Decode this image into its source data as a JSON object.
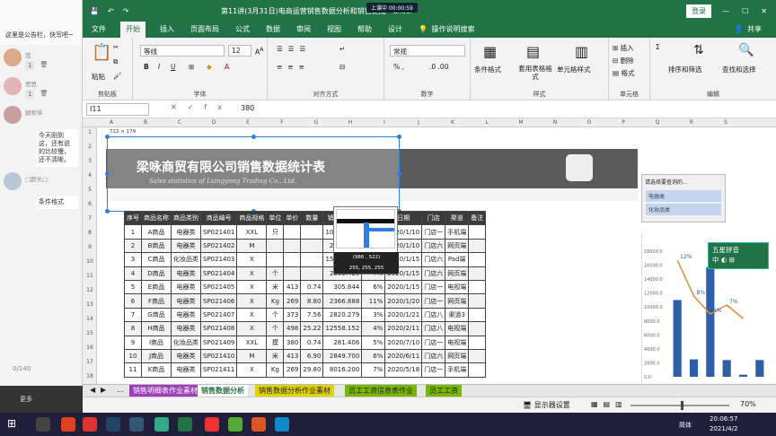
{
  "chat": {
    "notice": "这里是公告栏，快写吧~",
    "users": [
      {
        "name": "莲",
        "count": "1"
      },
      {
        "name": "思思",
        "count": "1"
      },
      {
        "name": "颖熙爷",
        "msg": "今天刚到这，还有说的比较慢，还不清晰。"
      },
      {
        "name": "□颜头□",
        "msg": "条件格式"
      }
    ],
    "counter": "0/140",
    "footer": "更多"
  },
  "window": {
    "title": "第11讲(3月31日)电商运营销售数据分析和销售提成 - Excel",
    "recording": "上课中 00:00:59",
    "login": "登录",
    "share": "共享"
  },
  "tabs": [
    "文件",
    "开始",
    "插入",
    "页面布局",
    "公式",
    "数据",
    "审阅",
    "视图",
    "帮助",
    "设计",
    "操作说明搜索"
  ],
  "ribbon": {
    "paste": "粘贴",
    "clipboard": "剪贴板",
    "font_name": "等线",
    "font_size": "12",
    "font": "字体",
    "align": "对齐方式",
    "num_format": "常规",
    "number": "数字",
    "cond": "条件格式",
    "table": "套用表格格式",
    "cellstyle": "单元格样式",
    "styles": "样式",
    "insert": "插入",
    "delete": "删除",
    "format": "格式",
    "cells": "单元格",
    "sort": "排序和筛选",
    "find": "查找和选择",
    "edit": "编辑"
  },
  "formula": {
    "name_box": "I11",
    "value": "380"
  },
  "banner": {
    "title": "梁咏商贸有限公司销售数据统计表",
    "subtitle": "Sales statistics of Liangyong Trading Co., Ltd.",
    "sel_dim": "722 × 179"
  },
  "table": {
    "headers": [
      "序号",
      "商品名称",
      "商品类别",
      "商品编号",
      "商品规格",
      "单位",
      "单价",
      "数量",
      "销售额(万)",
      "利润率",
      "日期",
      "门店",
      "渠道",
      "备注"
    ],
    "rows": [
      [
        "1",
        "A商品",
        "电器类",
        "SP021401",
        "XXL",
        "只",
        "",
        "",
        "10870.332",
        "12%",
        "2020/1/10",
        "门店一",
        "手机端",
        ""
      ],
      [
        "2",
        "B商品",
        "电器类",
        "SP021402",
        "M",
        "",
        "",
        "",
        "2566.228",
        "8%",
        "2020/1/10",
        "门店六",
        "网页端",
        ""
      ],
      [
        "3",
        "C商品",
        "化妆品类",
        "SP021403",
        "X",
        "",
        "",
        "",
        "15748.344",
        "6%",
        "2020/1/15",
        "门店六",
        "Pad端",
        ""
      ],
      [
        "4",
        "D商品",
        "电器类",
        "SP021404",
        "X",
        "个",
        "",
        "",
        "2363.420",
        "7%",
        "2020/1/15",
        "门店六",
        "网页端",
        ""
      ],
      [
        "5",
        "E商品",
        "电器类",
        "SP021405",
        "X",
        "米",
        "413",
        "0.74",
        "305.844",
        "6%",
        "2020/1/15",
        "门店一",
        "电视端",
        ""
      ],
      [
        "6",
        "F商品",
        "电器类",
        "SP021406",
        "X",
        "Kg",
        "269",
        "8.80",
        "2366.888",
        "11%",
        "2020/1/20",
        "门店一",
        "网页端",
        ""
      ],
      [
        "7",
        "G商品",
        "电器类",
        "SP021407",
        "X",
        "个",
        "373",
        "7.56",
        "2820.279",
        "3%",
        "2020/1/21",
        "门店八",
        "渠道3",
        ""
      ],
      [
        "8",
        "H商品",
        "电器类",
        "SP021408",
        "X",
        "个",
        "498",
        "25.22",
        "12558.152",
        "4%",
        "2020/2/11",
        "门店八",
        "电视端",
        ""
      ],
      [
        "9",
        "I商品",
        "化妆品类",
        "SP021409",
        "XXL",
        "摸",
        "380",
        "0.74",
        "281.406",
        "5%",
        "2020/7/10",
        "门店一",
        "电视端",
        ""
      ],
      [
        "10",
        "J商品",
        "电器类",
        "SP021410",
        "M",
        "米",
        "413",
        "6.90",
        "2849.700",
        "6%",
        "2020/6/11",
        "门店六",
        "网页端",
        ""
      ],
      [
        "11",
        "K商品",
        "电器类",
        "SP021411",
        "X",
        "Kg",
        "269",
        "29.80",
        "8016.200",
        "7%",
        "2020/5/18",
        "门店一",
        "手机端",
        ""
      ]
    ]
  },
  "picker": {
    "pos": "(986 , 522)",
    "rgb": "255, 255, 255"
  },
  "slicer": {
    "header": "请选择要查询的...",
    "items": [
      "电器类",
      "化妆品类"
    ]
  },
  "chart_data": {
    "type": "bar",
    "categories": [
      "",
      "",
      "",
      "",
      "",
      ""
    ],
    "values": [
      11000,
      2500,
      15700,
      2400,
      300,
      2400
    ],
    "line_labels": [
      "12%",
      "8%",
      "6%",
      "7%"
    ],
    "y_ticks": [
      "18000.0",
      "16000.0",
      "14000.0",
      "12000.0",
      "10000.0",
      "8000.0",
      "6000.0",
      "4000.0",
      "2000.0",
      "0.0"
    ],
    "ylim": [
      0,
      18000
    ]
  },
  "nav": {
    "title": "五星拼音",
    "sub": "中 ◐ ⊞"
  },
  "sheets": [
    "...",
    "销售明细表作业素材",
    "销售数据分析",
    "销售数据分析作业素材",
    "员工工资信息表作业",
    "员工工资"
  ],
  "status": {
    "display": "显示器设置",
    "zoom": "70%"
  },
  "taskbar": {
    "time": "20:06:57",
    "date": "2021/4/2",
    "lang": "简体"
  }
}
